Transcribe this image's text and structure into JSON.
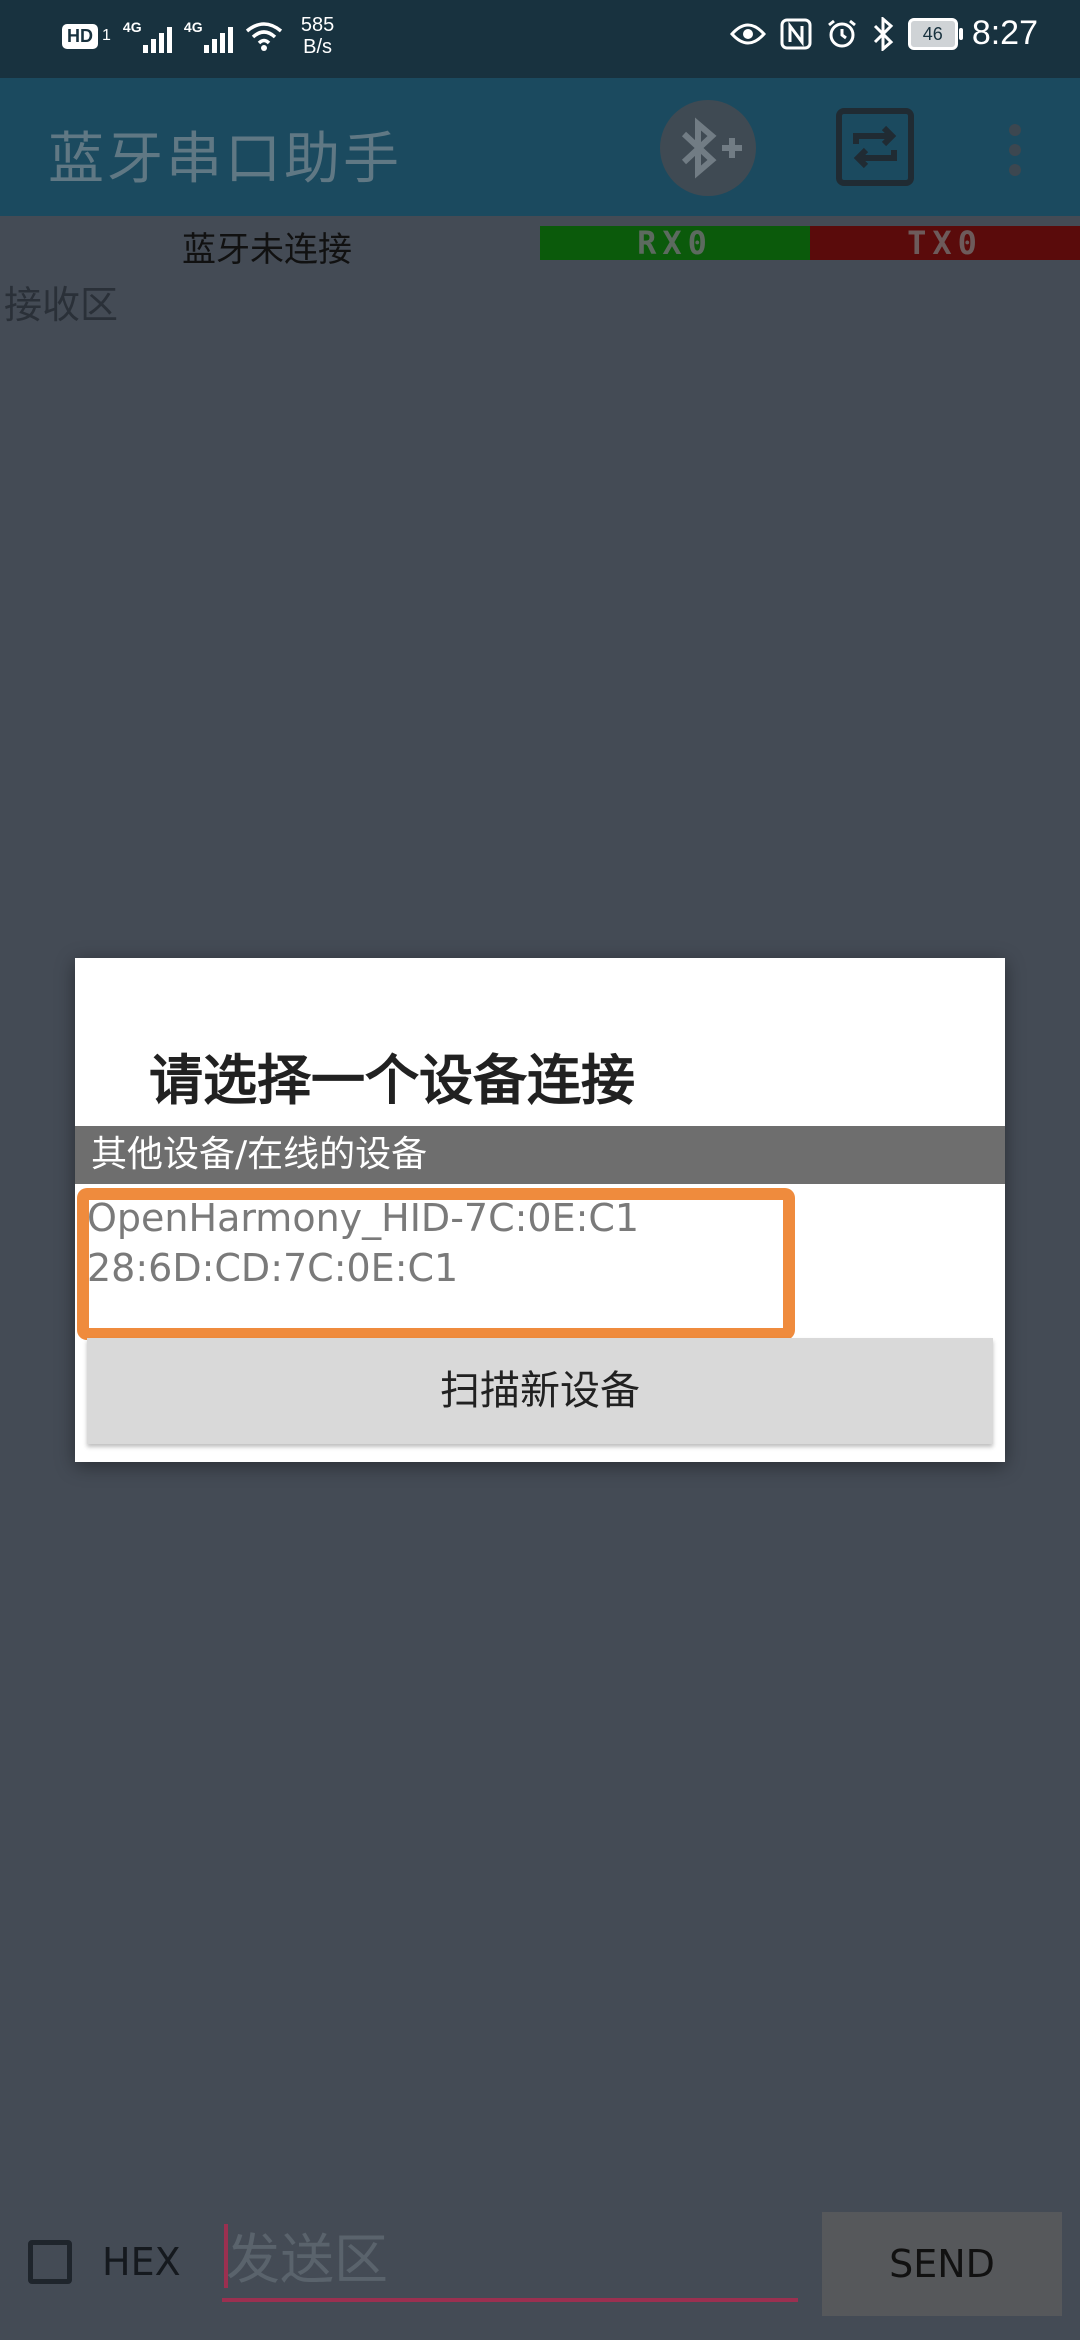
{
  "status_bar": {
    "hd_badge": "HD",
    "sim_badge": "1",
    "network_1": "4G",
    "network_2": "4G",
    "speed_value": "585",
    "speed_unit": "B/s",
    "battery": "46",
    "time": "8:27",
    "icons": [
      "eye-icon",
      "nfc-icon",
      "alarm-icon",
      "bluetooth-icon"
    ]
  },
  "app_bar": {
    "title": "蓝牙串口助手",
    "icons": [
      "bluetooth-add-icon",
      "repeat-icon",
      "overflow-menu-icon"
    ]
  },
  "connection": {
    "status": "蓝牙未连接",
    "rx": "RX0",
    "tx": "TX0",
    "rx_color": "#0b5a0b",
    "tx_color": "#5a0b0b"
  },
  "receive_area": {
    "label": "接收区"
  },
  "dialog": {
    "title": "请选择一个设备连接",
    "section_header": "其他设备/在线的设备",
    "devices": [
      {
        "name": "OpenHarmony_HID-7C:0E:C1",
        "mac": "28:6D:CD:7C:0E:C1"
      }
    ],
    "scan_button": "扫描新设备",
    "highlight_color": "#ef8b3d"
  },
  "bottom_bar": {
    "hex_label": "HEX",
    "hex_checked": false,
    "send_placeholder": "发送区",
    "send_value": "",
    "send_button": "SEND"
  }
}
